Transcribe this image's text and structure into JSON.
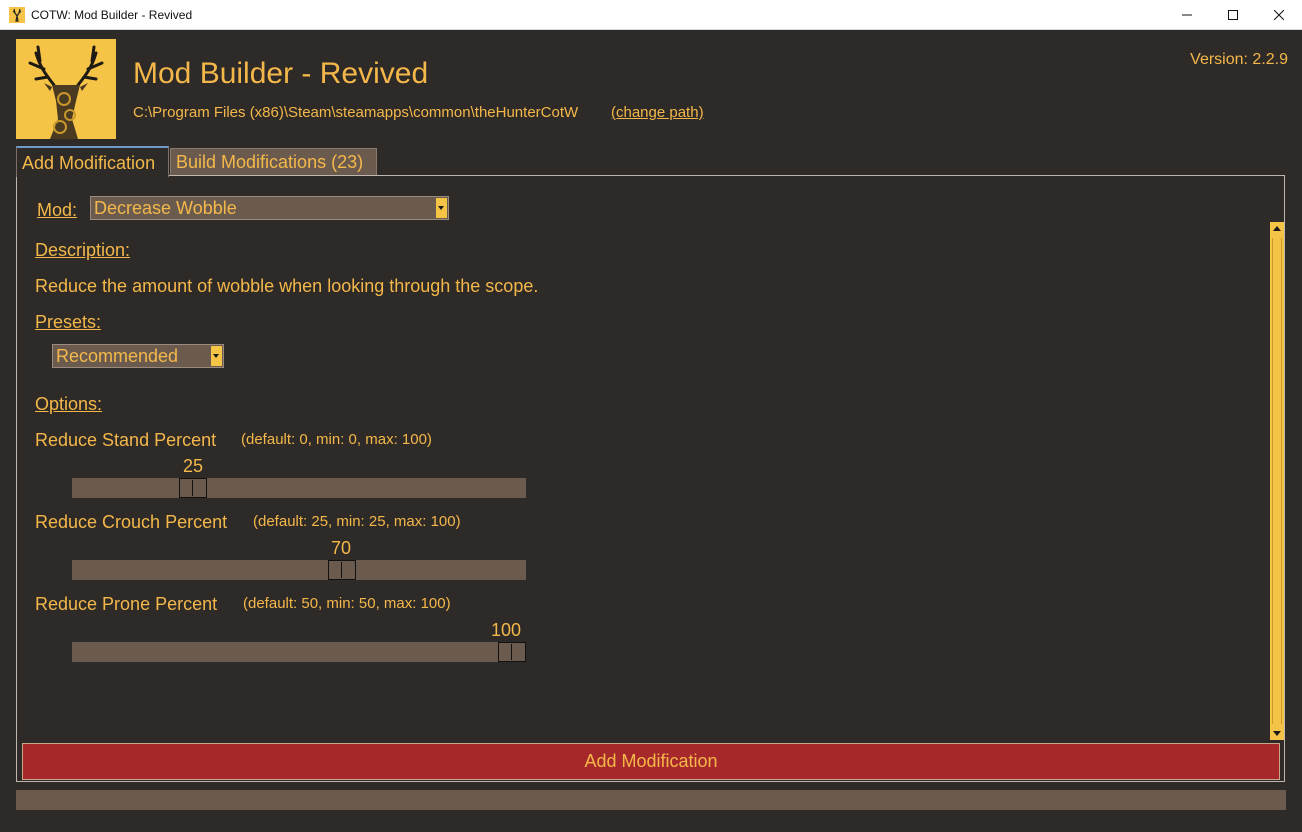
{
  "window": {
    "title": "COTW: Mod Builder - Revived"
  },
  "header": {
    "title": "Mod Builder - Revived",
    "path": "C:\\Program Files (x86)\\Steam\\steamapps\\common\\theHunterCotW",
    "change_path_label": "(change path)",
    "version": "Version: 2.2.9",
    "logo_icon": "deer-head-logo-icon"
  },
  "tabs": [
    {
      "label": "Add Modification",
      "active": true
    },
    {
      "label": "Build Modifications (23)",
      "active": false
    }
  ],
  "form": {
    "mod_label": "Mod:",
    "mod_selected": "Decrease Wobble",
    "description_label": "Description:",
    "description_text": "Reduce the amount of wobble when looking through the scope.",
    "presets_label": "Presets:",
    "preset_selected": "Recommended",
    "options_label": "Options:",
    "options": [
      {
        "label": "Reduce Stand Percent",
        "hint": "(default: 0, min: 0, max: 100)",
        "value": "25",
        "fraction": 0.25
      },
      {
        "label": "Reduce Crouch Percent",
        "hint": "(default: 25, min: 25, max: 100)",
        "value": "70",
        "fraction": 0.6
      },
      {
        "label": "Reduce Prone Percent",
        "hint": "(default: 50, min: 50, max: 100)",
        "value": "100",
        "fraction": 1.0
      }
    ]
  },
  "add_button_label": "Add Modification",
  "colors": {
    "accent": "#f4b84a",
    "background": "#2e2a27",
    "control": "#6b5b4f",
    "button": "#a6282a"
  }
}
